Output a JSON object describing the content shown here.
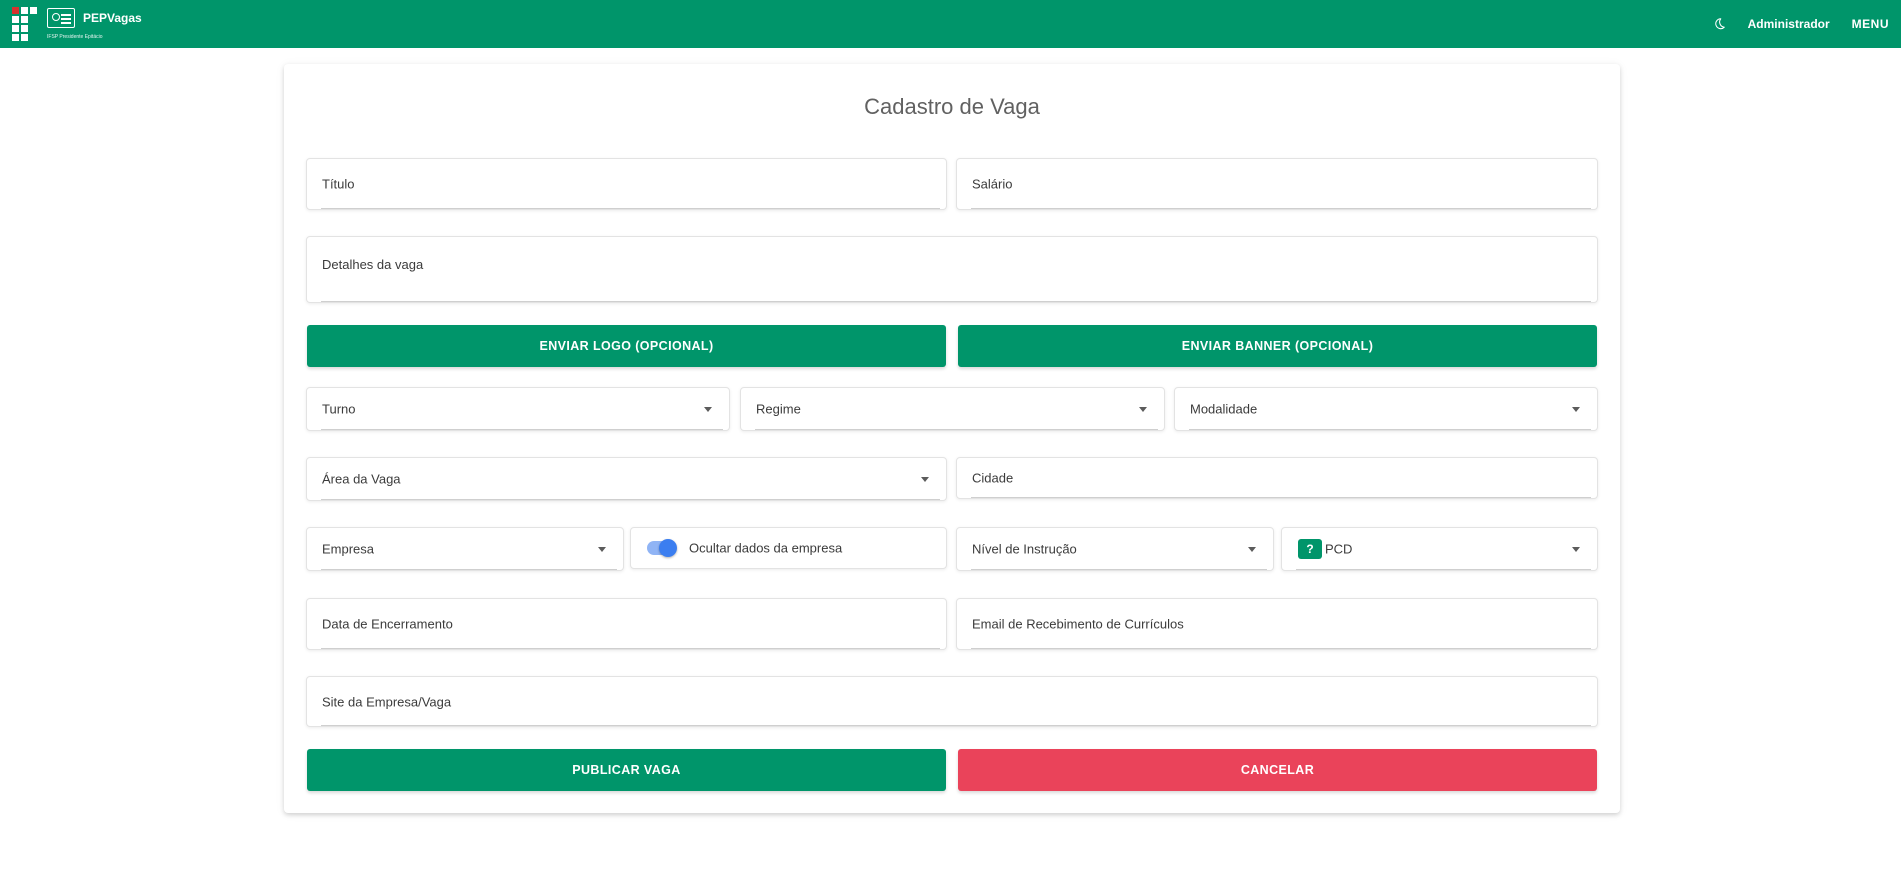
{
  "header": {
    "brand_title": "PEPVagas",
    "brand_subtitle": "IFSP Presidente Epitácio",
    "user_label": "Administrador",
    "menu_label": "MENU",
    "accent_color": "#00956a"
  },
  "form": {
    "title": "Cadastro de Vaga",
    "titulo_label": "Título",
    "salario_label": "Salário",
    "detalhes_label": "Detalhes da vaga",
    "enviar_logo_label": "ENVIAR LOGO (OPCIONAL)",
    "enviar_banner_label": "ENVIAR BANNER (OPCIONAL)",
    "turno_label": "Turno",
    "regime_label": "Regime",
    "modalidade_label": "Modalidade",
    "area_label": "Área da Vaga",
    "cidade_label": "Cidade",
    "empresa_label": "Empresa",
    "ocultar_label": "Ocultar dados da empresa",
    "ocultar_checked": true,
    "nivel_label": "Nível de Instrução",
    "pcd_help": "?",
    "pcd_label": "PCD",
    "data_encerramento_label": "Data de Encerramento",
    "email_label": "Email de Recebimento de Currículos",
    "site_label": "Site da Empresa/Vaga",
    "publicar_label": "PUBLICAR VAGA",
    "cancelar_label": "CANCELAR",
    "cancel_color": "#ea435a"
  }
}
